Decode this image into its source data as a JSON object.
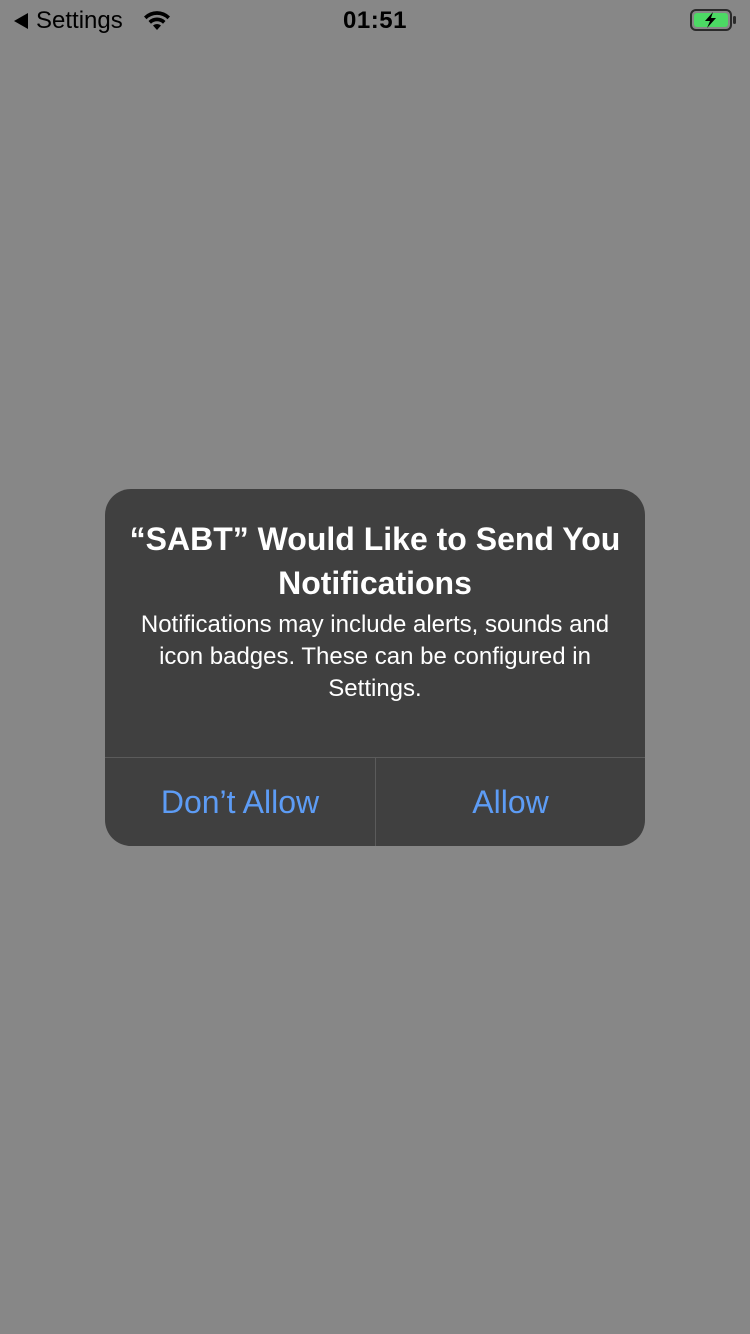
{
  "status_bar": {
    "back_label": "Settings",
    "time": "01:51",
    "icons": {
      "back": "back-arrow-icon",
      "wifi": "wifi-icon",
      "battery": "battery-charging-icon"
    },
    "battery_color": "#4cd964"
  },
  "alert": {
    "title": "“SABT” Would Like to Send You Notifications",
    "message": "Notifications may include alerts, sounds and icon badges. These can be configured in Settings.",
    "buttons": {
      "dont_allow": "Don’t Allow",
      "allow": "Allow"
    },
    "button_color": "#5d9cf5"
  },
  "colors": {
    "dimmed_background": "#878787",
    "alert_background": "#404040"
  }
}
